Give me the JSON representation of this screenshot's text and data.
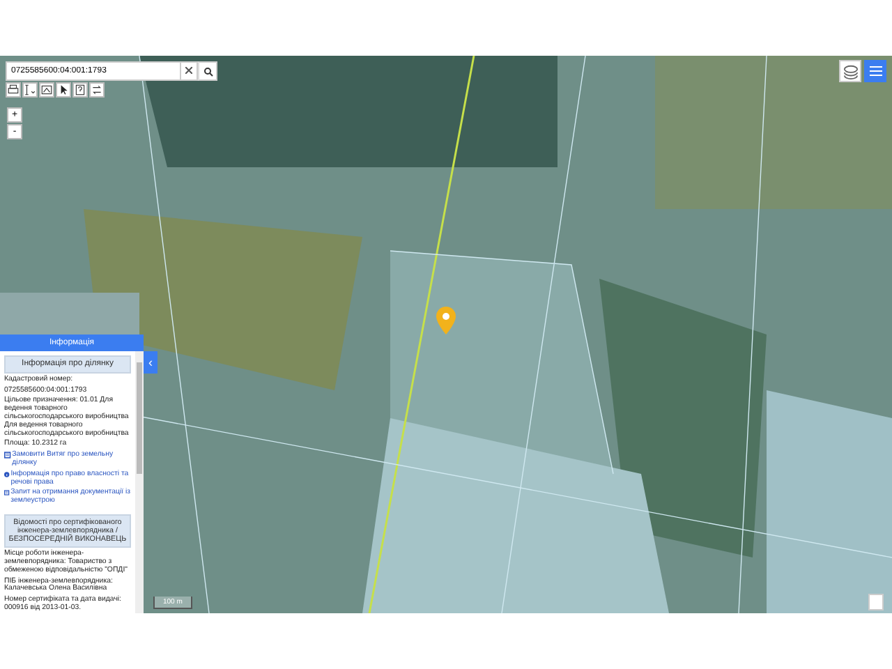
{
  "search": {
    "value": "0725585600:04:001:1793"
  },
  "toolbar": {
    "tools": [
      {
        "kind": "print"
      },
      {
        "kind": "measure"
      },
      {
        "kind": "select-area"
      },
      {
        "kind": "pointer"
      },
      {
        "kind": "help"
      },
      {
        "kind": "swap"
      }
    ]
  },
  "zoom": {
    "buttons": [
      "+",
      "-"
    ]
  },
  "info_panel": {
    "title": "Інформація",
    "collapse_button": "‹",
    "parcel_heading": "Інформація про ділянку",
    "lines": [
      "Кадастровий номер:",
      "0725585600:04:001:1793",
      "Цільове призначення: 01.01 Для ведення товарного сільськогосподарського виробництва Для ведення товарного сільськогосподарського виробництва",
      "Площа: 10.2312 га"
    ],
    "links": [
      {
        "kind": "document",
        "text": "Замовити Витяг про земельну ділянку"
      },
      {
        "kind": "info",
        "text": "Інформація про право власності та речові права"
      },
      {
        "kind": "document",
        "text": "Запит на отримання документації із землеустрою"
      }
    ],
    "engineer_heading": "Відомості про сертифікованого інженера-землевпорядника / БЕЗПОСЕРЕДНІЙ ВИКОНАВЕЦЬ",
    "engineer_lines": [
      "Місце роботи інженера-землевпорядника: Товариство з обмеженою відповідальністю \"ОПДІ\"",
      "ПІБ інженера-землевпорядника: Калачевська Олена Василівна",
      "Номер сертифіката та дата видачі: 000916 від 2013-01-03."
    ]
  },
  "scale": {
    "label": "100 m"
  }
}
